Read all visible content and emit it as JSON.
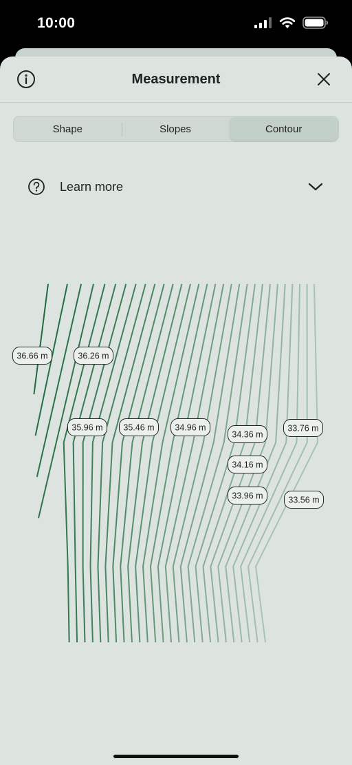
{
  "status_bar": {
    "time": "10:00"
  },
  "header": {
    "title": "Measurement"
  },
  "tabs": [
    {
      "label": "Shape",
      "active": false
    },
    {
      "label": "Slopes",
      "active": false
    },
    {
      "label": "Contour",
      "active": true
    }
  ],
  "learn_more": {
    "label": "Learn more"
  },
  "contour": {
    "line_color": "#1f6b3f",
    "labels": [
      "36.66 m",
      "36.26 m",
      "35.96 m",
      "35.46 m",
      "34.96 m",
      "34.36 m",
      "34.16 m",
      "33.96 m",
      "33.76 m",
      "33.56 m"
    ]
  }
}
